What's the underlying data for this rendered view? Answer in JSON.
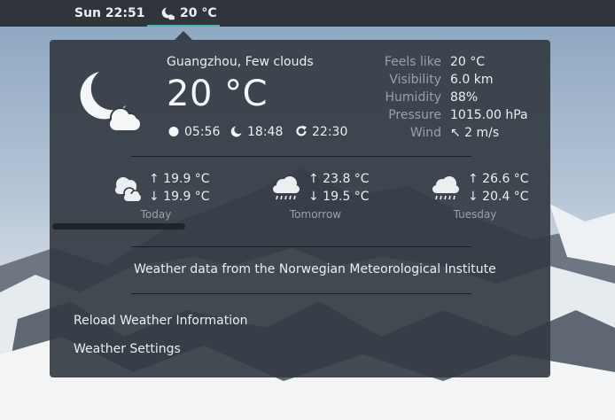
{
  "topbar": {
    "clock": "Sun 22:51",
    "weather_temp": "20 °C",
    "weather_icon": "night-few-clouds-icon"
  },
  "current": {
    "location": "Guangzhou, Few clouds",
    "temperature": "20 °C",
    "icon": "night-few-clouds-icon",
    "sunrise": "05:56",
    "sunset": "18:48",
    "last_update": "22:30"
  },
  "details": [
    {
      "label": "Feels like",
      "value": "20 °C"
    },
    {
      "label": "Visibility",
      "value": "6.0 km"
    },
    {
      "label": "Humidity",
      "value": "88%"
    },
    {
      "label": "Pressure",
      "value": "1015.00 hPa"
    },
    {
      "label": "Wind",
      "value": "↖ 2 m/s"
    }
  ],
  "forecast": [
    {
      "day": "Today",
      "high": "↑ 19.9 °C",
      "low": "↓ 19.9 °C",
      "icon": "day-cloudy-icon"
    },
    {
      "day": "Tomorrow",
      "high": "↑ 23.8 °C",
      "low": "↓ 19.5 °C",
      "icon": "rain-icon"
    },
    {
      "day": "Tuesday",
      "high": "↑ 26.6 °C",
      "low": "↓ 20.4 °C",
      "icon": "rain-icon"
    }
  ],
  "attribution": "Weather data from the Norwegian Meteorological Institute",
  "menu": {
    "reload": "Reload Weather Information",
    "settings": "Weather Settings"
  },
  "colors": {
    "panel": "#2a2e34",
    "popup": "#343b43",
    "accent": "#4fb5a9",
    "muted_text": "#98a1ab"
  }
}
